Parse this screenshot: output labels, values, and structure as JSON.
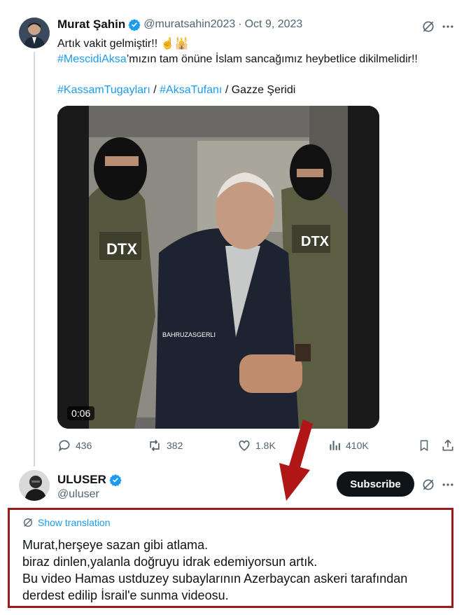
{
  "tweet": {
    "author_name": "Murat Şahin",
    "handle": "@muratsahin2023",
    "separator": "·",
    "date": "Oct 9, 2023",
    "line1": "Artık vakit gelmiştir!!",
    "line1_emoji": "☝🕌",
    "line2_hashtag": "#MescidiAksa",
    "line2_rest": "’mızın tam önüne İslam sancağımız heybetlice dikilmelidir!!",
    "line3": {
      "hashtag1": "#KassamTugayları",
      "sep1": " / ",
      "hashtag2": "#AksaTufanı",
      "sep2": " / ",
      "place": "Gazze Şeridi"
    },
    "video": {
      "duration": "0:06",
      "vest_text": "DTX",
      "watermark": "BAHRUZASGERLI"
    },
    "actions": {
      "replies": "436",
      "reposts": "382",
      "likes": "1.8K",
      "views": "410K"
    }
  },
  "reply": {
    "author_name": "ULUSER",
    "handle": "@uluser",
    "subscribe_label": "Subscribe",
    "show_translation": "Show translation",
    "lines": [
      "Murat,herşeye sazan gibi atlama.",
      "biraz dinlen,yalanla doğruyu idrak edemiyorsun artık.",
      "Bu video Hamas ustduzey subaylarının Azerbaycan askeri tarafından",
      "derdest edilip İsrail'e sunma videosu."
    ]
  },
  "colors": {
    "accent": "#1d9bf0",
    "annotation": "#b01616",
    "text": "#0f1419",
    "muted": "#536471"
  }
}
